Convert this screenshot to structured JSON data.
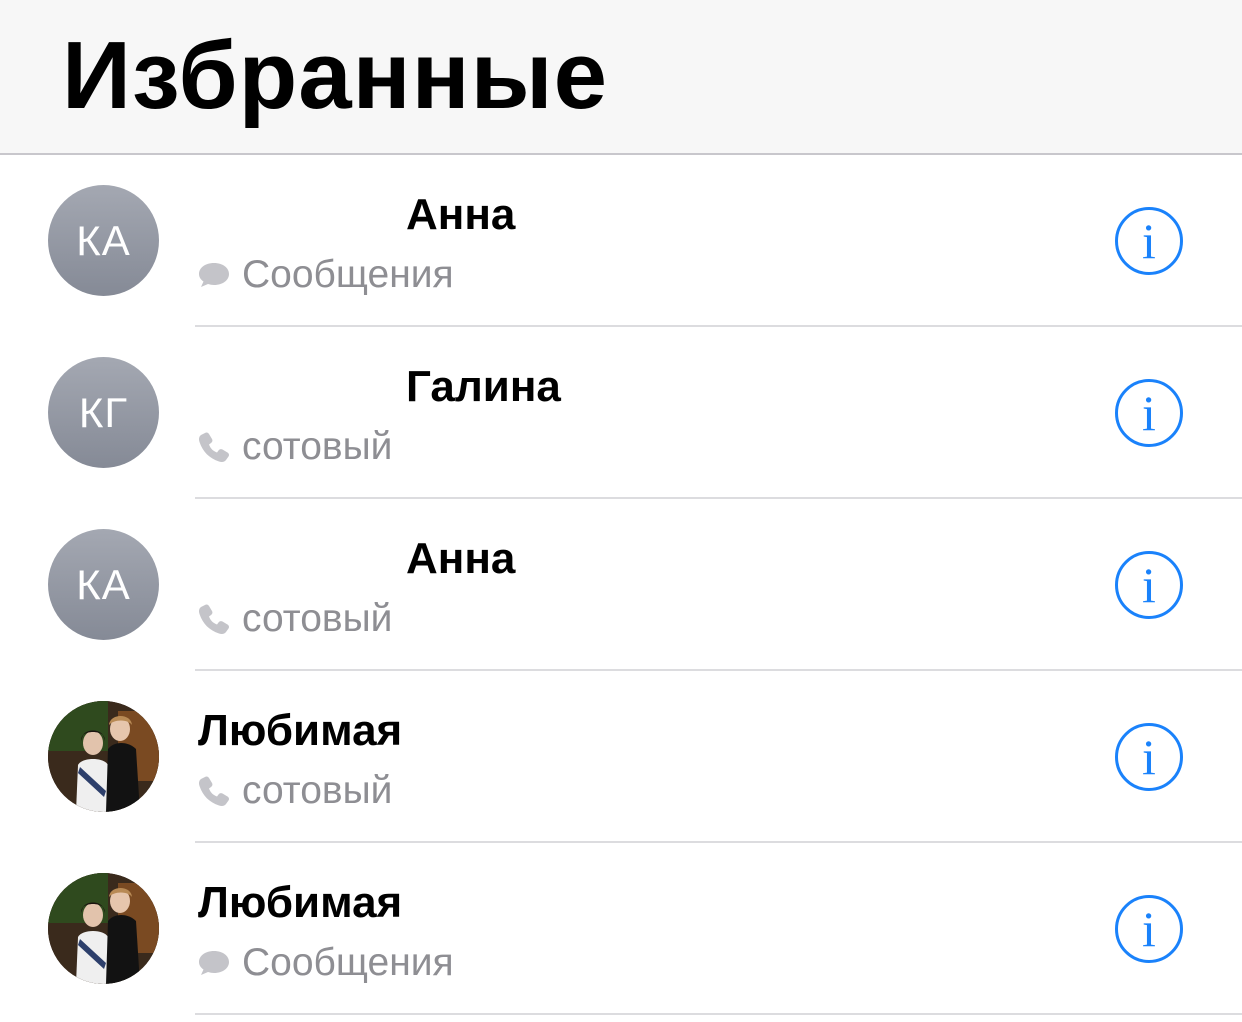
{
  "header": {
    "title": "Избранные"
  },
  "favorites": [
    {
      "initials": "КА",
      "name": "Анна",
      "method": "Сообщения",
      "method_icon": "message-bubble-icon"
    },
    {
      "initials": "КГ",
      "name": "Галина",
      "method": "сотовый",
      "method_icon": "phone-icon"
    },
    {
      "initials": "КА",
      "name": "Анна",
      "method": "сотовый",
      "method_icon": "phone-icon"
    },
    {
      "initials": "",
      "name": "Любимая",
      "method": "сотовый",
      "method_icon": "phone-icon",
      "avatar": "photo"
    },
    {
      "initials": "",
      "name": "Любимая",
      "method": "Сообщения",
      "method_icon": "message-bubble-icon",
      "avatar": "photo"
    }
  ],
  "info_glyph": "i",
  "colors": {
    "accent": "#1a82fb",
    "secondary_text": "#8e8e93",
    "avatar_gray": "#9a9ea8",
    "header_bg": "#f7f7f7"
  }
}
